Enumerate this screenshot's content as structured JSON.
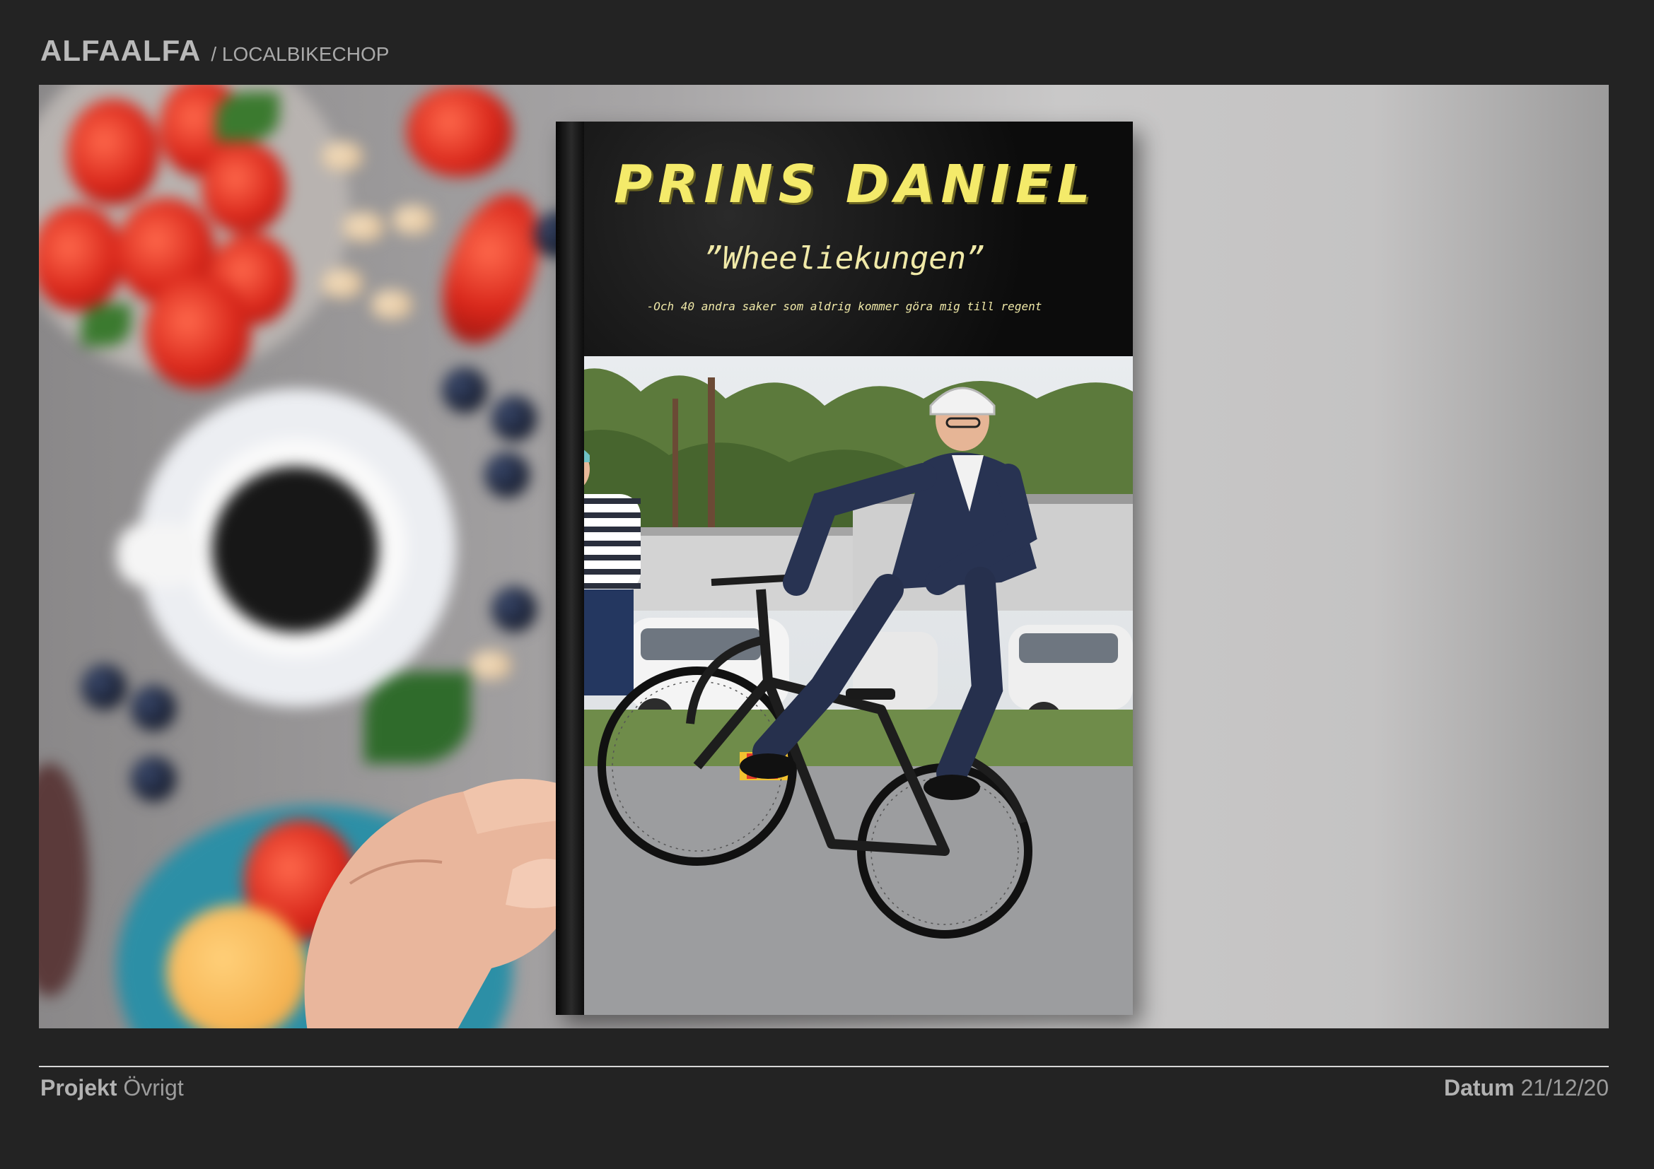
{
  "header": {
    "brand": "ALFAALFA",
    "subtitle": "/ LOCALBIKECHOP"
  },
  "book": {
    "title": "PRINS DANIEL",
    "subtitle": "”Wheeliekungen”",
    "tagline": "-Och 40 andra saker som aldrig kommer göra mig till regent"
  },
  "footer": {
    "project_label": "Projekt",
    "project_value": "Övrigt",
    "date_label": "Datum",
    "date_value": "21/12/20"
  },
  "colors": {
    "background": "#232323",
    "title_yellow": "#f4ea6a",
    "rule": "#d7d7d7"
  }
}
